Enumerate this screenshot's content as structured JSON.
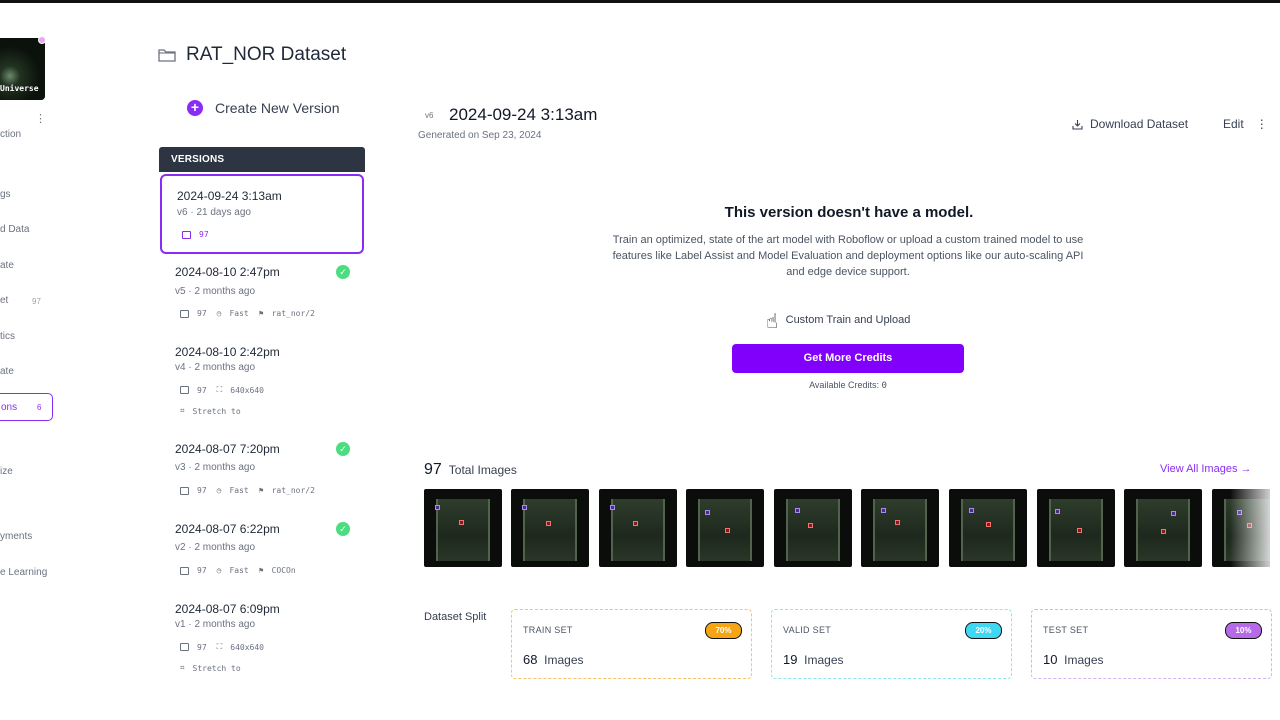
{
  "colors": {
    "accent": "#8b2cf5",
    "credits_button": "#8100fb",
    "check": "#4ade80",
    "train": "#f5a514",
    "valid": "#3ed8f2",
    "test": "#b66ae8"
  },
  "leftnav": {
    "logo_text": "Universe",
    "items": [
      {
        "label": "ction",
        "icon": "dataset-icon"
      },
      {
        "label": "gs",
        "icon": "tag-icon"
      },
      {
        "label": "d Data",
        "icon": "upload-icon"
      },
      {
        "label": "ate",
        "icon": "annotate-icon"
      },
      {
        "label": "et",
        "count": "97",
        "icon": "dataset-icon"
      },
      {
        "label": "tics",
        "icon": "analytics-icon"
      },
      {
        "label": "ate",
        "icon": "generate-icon"
      },
      {
        "label": "ons",
        "count": "6",
        "icon": "versions-icon",
        "active": true
      },
      {
        "label": "ize",
        "icon": "visualize-icon"
      },
      {
        "label": "yments",
        "icon": "deploy-icon"
      },
      {
        "label": "e Learning",
        "icon": "learning-icon"
      }
    ]
  },
  "dataset": {
    "title": "RAT_NOR Dataset",
    "create_version": "Create New Version"
  },
  "versions": {
    "header": "VERSIONS",
    "items": [
      {
        "date": "2024-09-24 3:13am",
        "meta": "v6 · 21 days ago",
        "images": "97",
        "tag2": "",
        "tag3": "",
        "extra": "",
        "trained": false
      },
      {
        "date": "2024-08-10 2:47pm",
        "meta": "v5 · 2 months ago",
        "images": "97",
        "tag2": "Fast",
        "tag3": "rat_nor/2",
        "extra": "",
        "trained": true
      },
      {
        "date": "2024-08-10 2:42pm",
        "meta": "v4 · 2 months ago",
        "images": "97",
        "tag2": "640x640",
        "tag3": "",
        "extra": "Stretch to",
        "trained": false
      },
      {
        "date": "2024-08-07 7:20pm",
        "meta": "v3 · 2 months ago",
        "images": "97",
        "tag2": "Fast",
        "tag3": "rat_nor/2",
        "extra": "",
        "trained": true
      },
      {
        "date": "2024-08-07 6:22pm",
        "meta": "v2 · 2 months ago",
        "images": "97",
        "tag2": "Fast",
        "tag3": "COCOn",
        "extra": "",
        "trained": true
      },
      {
        "date": "2024-08-07 6:09pm",
        "meta": "v1 · 2 months ago",
        "images": "97",
        "tag2": "640x640",
        "tag3": "",
        "extra": "Stretch to",
        "trained": false
      }
    ]
  },
  "main": {
    "version_badge": "v6",
    "version_date": "2024-09-24 3:13am",
    "generated": "Generated on Sep 23, 2024",
    "download": "Download Dataset",
    "edit": "Edit",
    "no_model_title": "This version doesn't have a model.",
    "no_model_desc": "Train an optimized, state of the art model with Roboflow or upload a custom trained model to use features like Label Assist and Model Evaluation and deployment options like our auto-scaling API and edge device support.",
    "custom_train": "Custom Train and Upload",
    "credits_button": "Get More Credits",
    "available_label": "Available Credits:",
    "available_value": "0",
    "total_count": "97",
    "total_label": "Total Images",
    "view_all": "View All Images →",
    "split_label": "Dataset Split",
    "splits": [
      {
        "name": "TRAIN SET",
        "pct": "70%",
        "count": "68",
        "unit": "Images"
      },
      {
        "name": "VALID SET",
        "pct": "20%",
        "count": "19",
        "unit": "Images"
      },
      {
        "name": "TEST SET",
        "pct": "10%",
        "count": "10",
        "unit": "Images"
      }
    ]
  }
}
